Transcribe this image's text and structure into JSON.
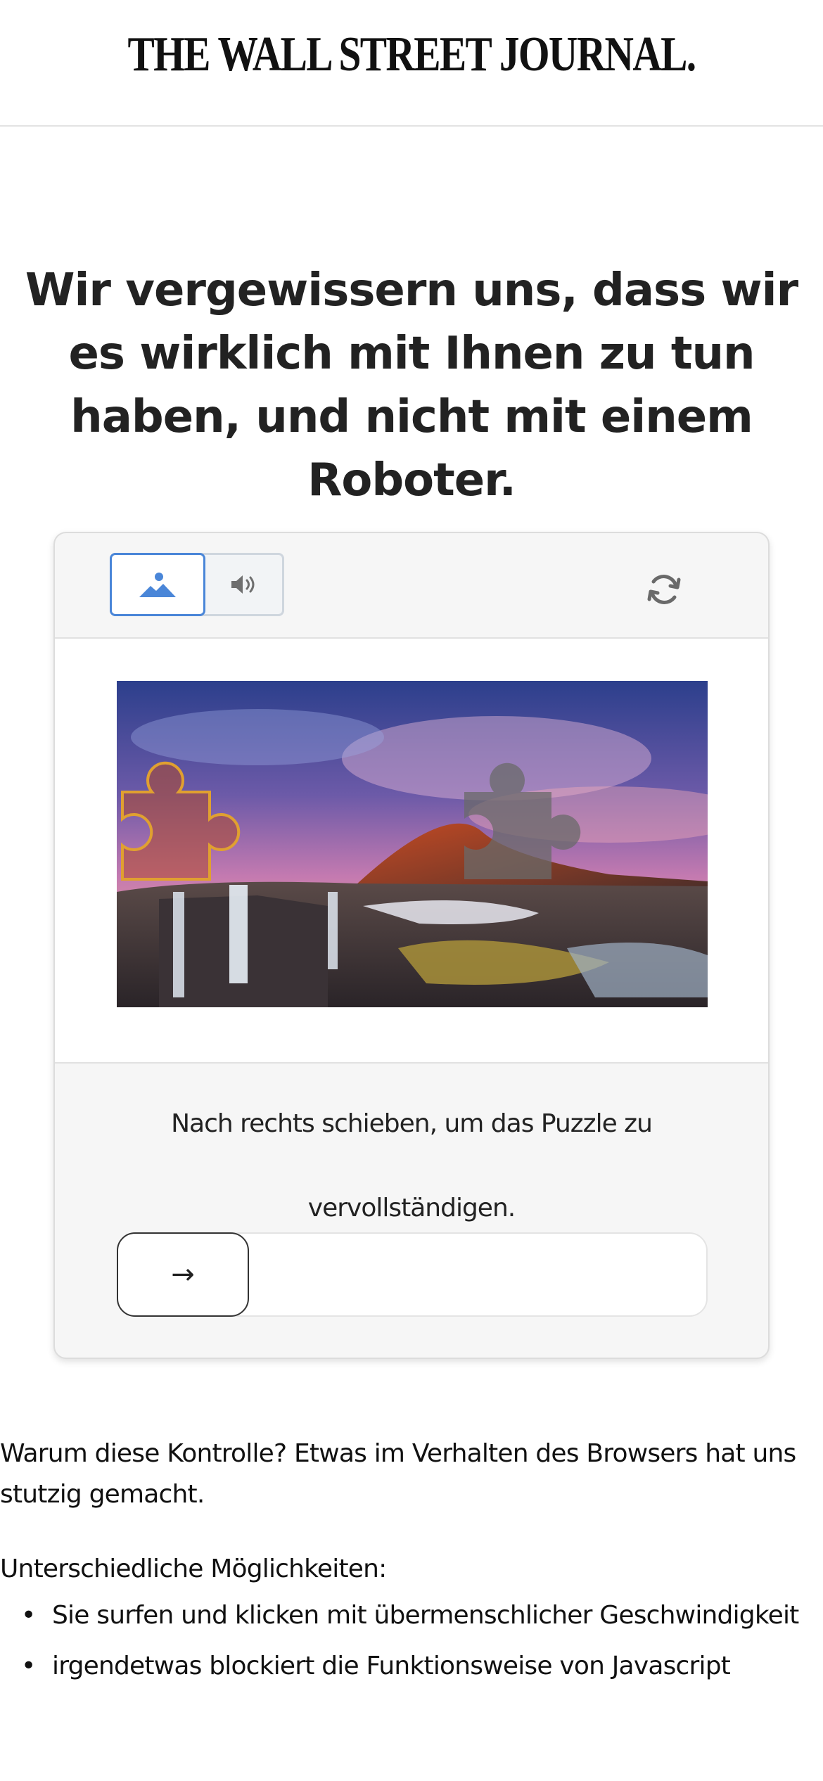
{
  "masthead": {
    "title": "THE WALL STREET JOURNAL."
  },
  "headline": "Wir vergewissern uns, dass wir es wirklich mit Ihnen zu tun haben, und nicht mit einem Roboter.",
  "captcha": {
    "modes": [
      {
        "name": "image-mode",
        "icon": "mountain-image-icon",
        "selected": true
      },
      {
        "name": "audio-mode",
        "icon": "speaker-icon",
        "selected": false
      }
    ],
    "refresh_icon": "refresh-icon",
    "instruction": "Nach rechts schieben, um das Puzzle zu vervollständigen.",
    "slider_arrow": "→",
    "slider_progress": 0,
    "colors": {
      "accent": "#4a86d8",
      "piece_outline": "#e0a030"
    }
  },
  "explanation": {
    "why": "Warum diese Kontrolle? Etwas im Verhalten des Browsers hat uns stutzig gemacht.",
    "possibilities_label": "Unterschiedliche Möglichkeiten:",
    "reasons": [
      "Sie surfen und klicken mit übermenschlicher Geschwindigkeit",
      "irgendetwas blockiert die Funktionsweise von Javascript"
    ]
  }
}
